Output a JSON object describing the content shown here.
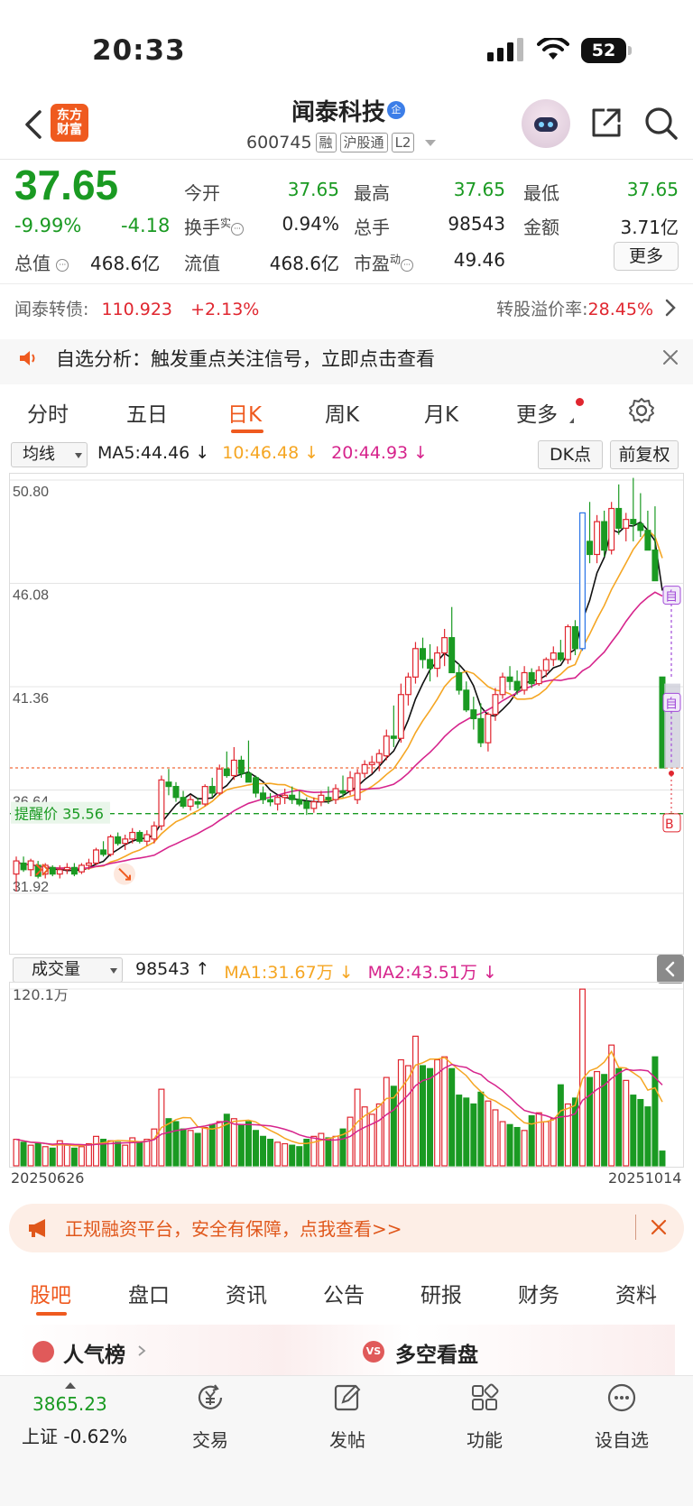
{
  "status_bar": {
    "time": "20:33",
    "battery": "52"
  },
  "header": {
    "logo_line1": "东方",
    "logo_line2": "财富",
    "stock_name": "闻泰科技",
    "badge": "企",
    "code": "600745",
    "tags": [
      "融",
      "沪股通",
      "L2"
    ]
  },
  "quote": {
    "price": "37.65",
    "change_pct": "-9.99%",
    "change": "-4.18",
    "mcap_label": "总值",
    "mcap": "468.6亿",
    "fields": [
      {
        "label": "今开",
        "value": "37.65",
        "color": "green"
      },
      {
        "label": "最高",
        "value": "37.65",
        "color": "green"
      },
      {
        "label": "最低",
        "value": "37.65",
        "color": "green"
      },
      {
        "label": "换手",
        "sup": "实",
        "value": "0.94%",
        "color": "black"
      },
      {
        "label": "总手",
        "value": "98543",
        "color": "black"
      },
      {
        "label": "金额",
        "value": "3.71亿",
        "color": "black"
      },
      {
        "label": "流值",
        "value": "468.6亿",
        "color": "black"
      },
      {
        "label": "市盈",
        "sup": "动",
        "value": "49.46",
        "color": "black"
      }
    ],
    "more_label": "更多"
  },
  "bond": {
    "label": "闻泰转债:",
    "price": "110.923",
    "change": "+2.13%",
    "premium_label": "转股溢价率:",
    "premium": "28.45%"
  },
  "notice": {
    "text": "自选分析：触发重点关注信号，立即点击查看"
  },
  "chart_tabs": [
    "分时",
    "五日",
    "日K",
    "周K",
    "月K",
    "更多"
  ],
  "active_tab": "日K",
  "ma_bar": {
    "select": "均线",
    "ma5": "MA5:44.46 ↓",
    "ma10": "10:46.48 ↓",
    "ma20": "20:44.93 ↓",
    "dk": "DK点",
    "adjust": "前复权"
  },
  "chart_data": {
    "type": "candlestick",
    "y_ticks": [
      "50.80",
      "46.08",
      "41.36",
      "36.64",
      "31.92"
    ],
    "ylim": [
      31.92,
      50.8
    ],
    "alert": {
      "label": "提醒价 35.56",
      "value": 35.56
    },
    "last_close": 37.65,
    "markers": [
      "自",
      "自",
      "B"
    ],
    "colors": {
      "up": "#e0262f",
      "down": "#1a9a22",
      "ma5": "#111111",
      "ma10": "#f5a623",
      "ma20": "#d6248c"
    },
    "candles": [
      [
        32.8,
        33.6,
        32.0,
        33.4
      ],
      [
        33.3,
        33.6,
        32.9,
        33.0
      ],
      [
        33.0,
        33.5,
        32.7,
        33.4
      ],
      [
        33.2,
        33.4,
        32.6,
        32.7
      ],
      [
        32.8,
        33.3,
        32.6,
        33.2
      ],
      [
        33.1,
        33.2,
        32.7,
        32.8
      ],
      [
        32.8,
        33.2,
        32.6,
        33.0
      ],
      [
        33.0,
        33.3,
        32.8,
        33.1
      ],
      [
        33.1,
        33.3,
        32.7,
        32.8
      ],
      [
        32.9,
        33.3,
        32.8,
        33.2
      ],
      [
        33.2,
        33.5,
        33.0,
        33.3
      ],
      [
        33.3,
        34.0,
        33.2,
        33.9
      ],
      [
        33.9,
        34.3,
        33.6,
        33.7
      ],
      [
        33.7,
        34.6,
        33.6,
        34.5
      ],
      [
        34.5,
        34.7,
        34.1,
        34.2
      ],
      [
        34.2,
        34.6,
        33.9,
        34.4
      ],
      [
        34.4,
        34.9,
        34.2,
        34.7
      ],
      [
        34.7,
        34.8,
        34.2,
        34.3
      ],
      [
        34.3,
        34.8,
        34.1,
        34.6
      ],
      [
        34.4,
        35.2,
        34.2,
        35.0
      ],
      [
        35.0,
        37.3,
        34.8,
        37.1
      ],
      [
        37.0,
        37.6,
        36.4,
        36.8
      ],
      [
        36.8,
        37.0,
        36.1,
        36.3
      ],
      [
        36.3,
        36.6,
        35.8,
        35.9
      ],
      [
        35.9,
        36.4,
        35.7,
        36.2
      ],
      [
        36.1,
        36.3,
        35.8,
        36.0
      ],
      [
        36.0,
        36.9,
        35.9,
        36.8
      ],
      [
        36.8,
        37.2,
        36.3,
        36.5
      ],
      [
        36.5,
        37.8,
        36.4,
        37.6
      ],
      [
        37.6,
        38.4,
        37.2,
        37.3
      ],
      [
        37.3,
        38.6,
        37.1,
        38.0
      ],
      [
        38.0,
        38.2,
        37.2,
        37.4
      ],
      [
        37.4,
        38.9,
        37.2,
        37.0
      ],
      [
        37.2,
        37.3,
        36.3,
        36.5
      ],
      [
        36.5,
        36.8,
        36.0,
        36.2
      ],
      [
        36.2,
        36.5,
        35.9,
        36.1
      ],
      [
        36.0,
        36.4,
        35.7,
        36.3
      ],
      [
        36.3,
        36.7,
        36.0,
        36.4
      ],
      [
        36.4,
        36.8,
        36.0,
        36.2
      ],
      [
        36.2,
        36.6,
        35.9,
        36.0
      ],
      [
        36.1,
        36.3,
        35.5,
        35.8
      ],
      [
        35.8,
        36.3,
        35.6,
        36.1
      ],
      [
        36.1,
        36.6,
        35.9,
        36.4
      ],
      [
        36.3,
        36.8,
        36.0,
        36.2
      ],
      [
        36.2,
        36.9,
        36.0,
        36.7
      ],
      [
        36.6,
        37.3,
        36.3,
        36.5
      ],
      [
        36.6,
        37.5,
        36.4,
        37.2
      ],
      [
        36.2,
        37.6,
        36.0,
        37.4
      ],
      [
        37.4,
        38.0,
        37.2,
        37.8
      ],
      [
        37.8,
        38.2,
        37.4,
        37.9
      ],
      [
        37.9,
        38.5,
        37.5,
        38.3
      ],
      [
        38.2,
        39.4,
        38.0,
        39.1
      ],
      [
        39.1,
        40.5,
        38.6,
        39.0
      ],
      [
        39.0,
        41.5,
        38.8,
        41.0
      ],
      [
        41.0,
        42.0,
        40.5,
        41.8
      ],
      [
        41.8,
        43.4,
        41.5,
        43.1
      ],
      [
        43.1,
        43.6,
        42.2,
        42.6
      ],
      [
        42.6,
        43.3,
        41.6,
        42.2
      ],
      [
        42.2,
        43.2,
        41.8,
        42.9
      ],
      [
        42.9,
        44.0,
        42.3,
        43.6
      ],
      [
        43.6,
        45.0,
        43.0,
        42.0
      ],
      [
        42.0,
        42.4,
        41.0,
        41.2
      ],
      [
        41.2,
        41.6,
        40.2,
        40.3
      ],
      [
        40.3,
        40.9,
        39.4,
        39.9
      ],
      [
        39.9,
        40.6,
        38.6,
        38.8
      ],
      [
        38.8,
        40.2,
        38.4,
        40.1
      ],
      [
        40.1,
        41.3,
        39.8,
        41.0
      ],
      [
        41.0,
        42.0,
        40.8,
        41.8
      ],
      [
        41.8,
        42.3,
        41.2,
        41.6
      ],
      [
        41.6,
        42.1,
        41.0,
        41.2
      ],
      [
        41.2,
        42.3,
        41.0,
        42.0
      ],
      [
        42.0,
        42.2,
        41.3,
        41.5
      ],
      [
        41.5,
        42.3,
        41.4,
        42.1
      ],
      [
        42.1,
        42.7,
        41.8,
        42.6
      ],
      [
        42.6,
        43.2,
        42.3,
        42.9
      ],
      [
        42.9,
        43.5,
        42.5,
        42.6
      ],
      [
        42.6,
        44.2,
        42.4,
        44.1
      ],
      [
        44.1,
        44.4,
        42.8,
        43.1
      ],
      [
        43.1,
        49.3,
        43.0,
        49.3
      ],
      [
        48.0,
        49.8,
        47.0,
        47.4
      ],
      [
        47.4,
        49.2,
        47.0,
        48.9
      ],
      [
        48.9,
        49.4,
        47.3,
        47.6
      ],
      [
        47.6,
        49.8,
        47.4,
        49.5
      ],
      [
        49.5,
        50.6,
        48.3,
        48.6
      ],
      [
        48.6,
        49.3,
        48.0,
        49.0
      ],
      [
        49.0,
        50.9,
        48.0,
        48.8
      ],
      [
        48.8,
        50.2,
        48.2,
        48.5
      ],
      [
        48.5,
        49.4,
        47.6,
        47.6
      ],
      [
        47.6,
        49.6,
        47.2,
        46.2
      ],
      [
        41.8,
        41.8,
        37.65,
        37.65
      ]
    ],
    "volume": {
      "label": "成交量",
      "current": "98543 ↑",
      "ma1": "MA1:31.67万 ↓",
      "ma2": "MA2:43.51万 ↓",
      "max_label": "120.1万",
      "max": 120.1,
      "bars": [
        18,
        16,
        14,
        15,
        13,
        12,
        17,
        14,
        12,
        13,
        15,
        20,
        18,
        17,
        16,
        14,
        19,
        16,
        18,
        25,
        52,
        32,
        30,
        25,
        24,
        22,
        26,
        28,
        30,
        35,
        32,
        28,
        30,
        24,
        20,
        18,
        16,
        15,
        14,
        13,
        18,
        20,
        22,
        19,
        20,
        25,
        33,
        52,
        40,
        35,
        42,
        60,
        54,
        72,
        68,
        88,
        68,
        66,
        72,
        74,
        66,
        48,
        46,
        42,
        50,
        44,
        38,
        30,
        28,
        26,
        24,
        34,
        36,
        30,
        32,
        55,
        42,
        46,
        120,
        60,
        64,
        62,
        82,
        66,
        58,
        48,
        45,
        40,
        74,
        10
      ]
    },
    "x_start": "20250626",
    "x_end": "20251014"
  },
  "ad": {
    "text": "正规融资平台，安全有保障，点我查看>>"
  },
  "bottom_tabs": [
    "股吧",
    "盘口",
    "资讯",
    "公告",
    "研报",
    "财务",
    "资料"
  ],
  "active_bottom_tab": "股吧",
  "cards": {
    "popular": "人气榜",
    "vs": "多空看盘",
    "vs_badge": "VS"
  },
  "bottom_nav": {
    "index_value": "3865.23",
    "index_label": "上证 -0.62%",
    "items": [
      "交易",
      "发帖",
      "功能",
      "设自选"
    ]
  }
}
